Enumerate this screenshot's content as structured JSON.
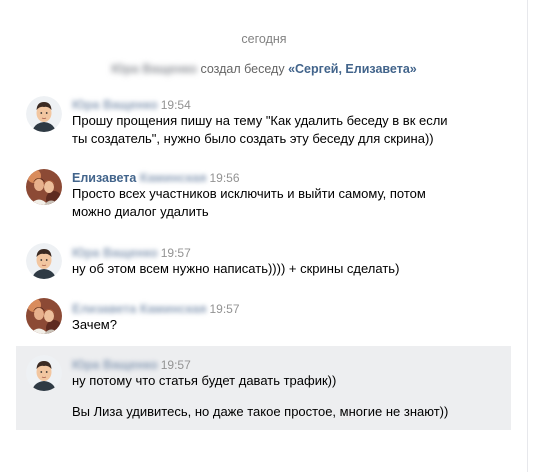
{
  "date_separator": "сегодня",
  "service": {
    "actor": "Юра Ващенко",
    "action": "создал беседу",
    "conversation_name": "«Сергей, Елизавета»"
  },
  "messages": [
    {
      "author": "Юра Ващенко",
      "time": "19:54",
      "avatar": "male-avatar-icon",
      "lines": [
        "Прошу прощения пишу на тему \"Как удалить беседу в вк если",
        "ты создатель\", нужно было создать эту беседу для скрина))"
      ]
    },
    {
      "author_visible": "Елизавета",
      "author_hidden": "Каминская",
      "time": "19:56",
      "avatar": "female-photo-avatar",
      "lines": [
        "Просто всех участников исключить и выйти самому, потом",
        "можно диалог удалить"
      ]
    },
    {
      "author": "Юра Ващенко",
      "time": "19:57",
      "avatar": "male-avatar-icon",
      "lines": [
        "ну об этом всем нужно написать)))) + скрины сделать)"
      ]
    },
    {
      "author": "Елизавета Каминская",
      "time": "19:57",
      "avatar": "female-photo-avatar",
      "lines": [
        "Зачем?"
      ]
    },
    {
      "author": "Юра Ващенко",
      "time": "19:57",
      "avatar": "male-avatar-icon",
      "selected": true,
      "lines": [
        "ну потому что статья будет давать трафик))",
        "Вы Лиза удивитесь, но даже такое простое, многие не знают))"
      ]
    }
  ],
  "colors": {
    "author_link": "#42648b",
    "time": "#939393",
    "selected_background": "#edeef0",
    "service_text": "#656565"
  }
}
